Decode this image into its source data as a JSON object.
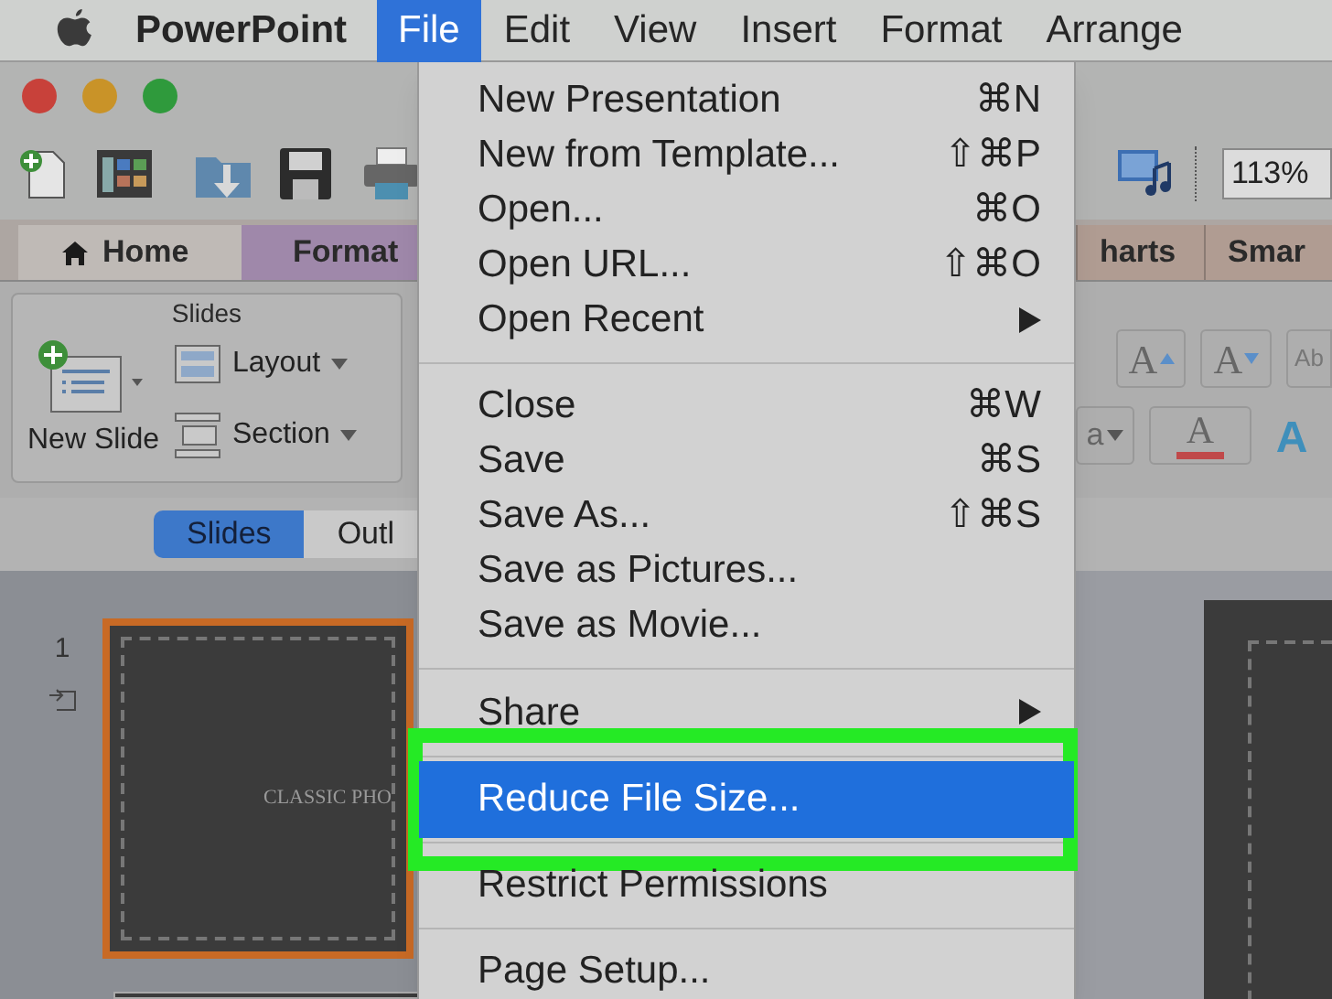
{
  "menu_bar": {
    "items": [
      {
        "label": "PowerPoint",
        "kind": "app",
        "selected": false
      },
      {
        "label": "File",
        "kind": "menu",
        "selected": true
      },
      {
        "label": "Edit",
        "kind": "menu",
        "selected": false
      },
      {
        "label": "View",
        "kind": "menu",
        "selected": false
      },
      {
        "label": "Insert",
        "kind": "menu",
        "selected": false
      },
      {
        "label": "Format",
        "kind": "menu",
        "selected": false
      },
      {
        "label": "Arrange",
        "kind": "menu",
        "selected": false
      }
    ]
  },
  "toolbar": {
    "zoom": "113%"
  },
  "ribbon_tabs": [
    {
      "label": "Home",
      "kind": "home",
      "selected": true
    },
    {
      "label": "Format",
      "kind": "contextual",
      "selected": false
    },
    {
      "label": "harts",
      "kind": "plain",
      "selected": false
    },
    {
      "label": "Smar",
      "kind": "plain",
      "selected": false
    }
  ],
  "ribbon": {
    "group_title": "Slides",
    "new_slide": "New Slide",
    "layout": "Layout",
    "section": "Section",
    "font_fragment": "a",
    "grow_font": "A",
    "shrink_font": "A",
    "styles": "Ab",
    "font_color": "A",
    "text_effects": "A"
  },
  "view_tabs": [
    {
      "label": "Slides",
      "selected": true
    },
    {
      "label": "Outl",
      "selected": false
    }
  ],
  "slides": [
    {
      "number": "1",
      "title": "CLASSIC PHO",
      "selected": true
    }
  ],
  "file_menu": {
    "items": [
      {
        "kind": "item",
        "label": "New Presentation",
        "shortcut": "⌘N",
        "selected": false,
        "outlined": false
      },
      {
        "kind": "item",
        "label": "New from Template...",
        "shortcut": "⇧⌘P",
        "selected": false,
        "outlined": false
      },
      {
        "kind": "item",
        "label": "Open...",
        "shortcut": "⌘O",
        "selected": false,
        "outlined": false
      },
      {
        "kind": "item",
        "label": "Open URL...",
        "shortcut": "⇧⌘O",
        "selected": false,
        "outlined": false
      },
      {
        "kind": "item",
        "label": "Open Recent",
        "submenu": true,
        "selected": false,
        "outlined": false
      },
      {
        "kind": "separator"
      },
      {
        "kind": "item",
        "label": "Close",
        "shortcut": "⌘W",
        "selected": false,
        "outlined": false
      },
      {
        "kind": "item",
        "label": "Save",
        "shortcut": "⌘S",
        "selected": false,
        "outlined": false
      },
      {
        "kind": "item",
        "label": "Save As...",
        "shortcut": "⇧⌘S",
        "selected": false,
        "outlined": false
      },
      {
        "kind": "item",
        "label": "Save as Pictures...",
        "selected": false,
        "outlined": false
      },
      {
        "kind": "item",
        "label": "Save as Movie...",
        "selected": false,
        "outlined": false
      },
      {
        "kind": "separator"
      },
      {
        "kind": "item",
        "label": "Share",
        "submenu": true,
        "selected": false,
        "outlined": false
      },
      {
        "kind": "separator"
      },
      {
        "kind": "item",
        "label": "Reduce File Size...",
        "selected": true,
        "outlined": true
      },
      {
        "kind": "separator"
      },
      {
        "kind": "item",
        "label": "Restrict Permissions",
        "selected": false,
        "outlined": false
      },
      {
        "kind": "separator"
      },
      {
        "kind": "item",
        "label": "Page Setup...",
        "selected": false,
        "outlined": false
      }
    ]
  }
}
